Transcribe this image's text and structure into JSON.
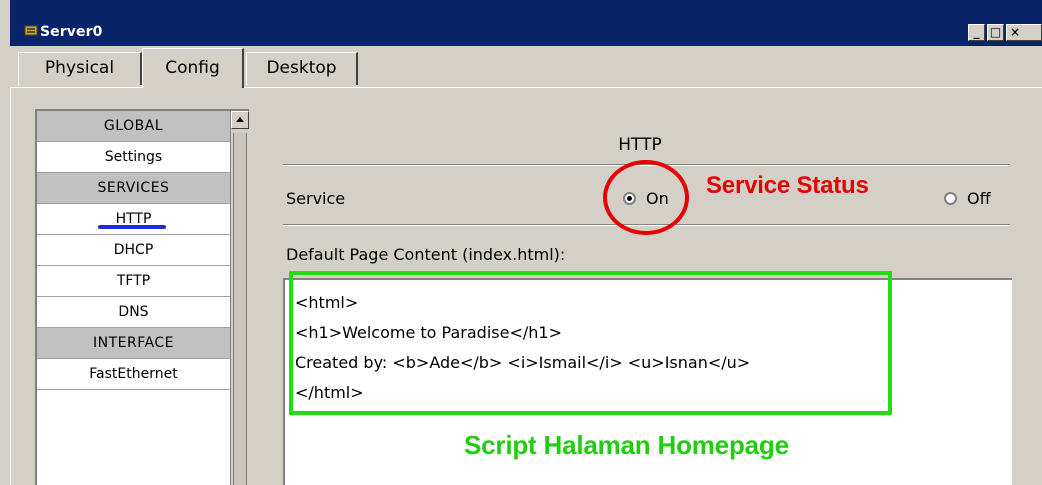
{
  "window": {
    "title": "Server0",
    "controls": [
      "_",
      "□",
      "×"
    ]
  },
  "tabs": [
    {
      "label": "Physical",
      "active": false
    },
    {
      "label": "Config",
      "active": true
    },
    {
      "label": "Desktop",
      "active": false
    }
  ],
  "sidebar": {
    "items": [
      {
        "label": "GLOBAL",
        "type": "header"
      },
      {
        "label": "Settings",
        "type": "item"
      },
      {
        "label": "SERVICES",
        "type": "header"
      },
      {
        "label": "HTTP",
        "type": "item",
        "selected": true
      },
      {
        "label": "DHCP",
        "type": "item"
      },
      {
        "label": "TFTP",
        "type": "item"
      },
      {
        "label": "DNS",
        "type": "item"
      },
      {
        "label": "INTERFACE",
        "type": "header"
      },
      {
        "label": "FastEthernet",
        "type": "item"
      }
    ]
  },
  "main": {
    "section_title": "HTTP",
    "service_label": "Service",
    "service_on_label": "On",
    "service_off_label": "Off",
    "service_state": "On",
    "content_label": "Default Page Content (index.html):",
    "content_lines": [
      "<html>",
      "<h1>Welcome to Paradise</h1>",
      "Created by: <b>Ade</b> <i>Ismail</i> <u>Isnan</u>",
      "</html>"
    ]
  },
  "annotations": {
    "service_status": "Service Status",
    "script_caption": "Script Halaman Homepage"
  },
  "colors": {
    "titlebar": "#0a246a",
    "annotation_red": "#e60000",
    "annotation_green": "#22cc11",
    "underline_blue": "#1a2ee0"
  }
}
